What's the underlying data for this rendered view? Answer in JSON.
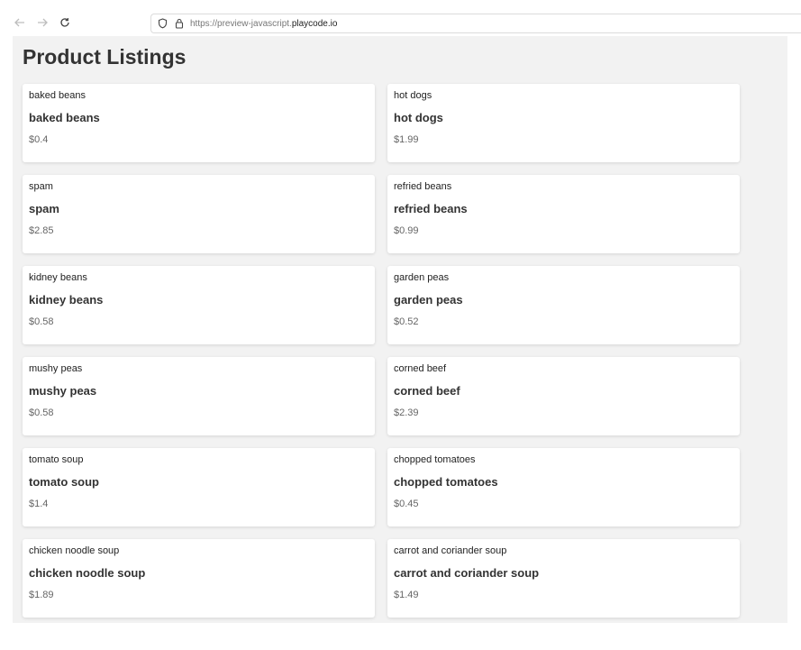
{
  "browser": {
    "url_prefix": "https://preview-javascript.",
    "url_host": "playcode.io"
  },
  "page": {
    "title": "Product Listings"
  },
  "products": [
    {
      "image_alt": "baked beans",
      "name": "baked beans",
      "price": "$0.4"
    },
    {
      "image_alt": "hot dogs",
      "name": "hot dogs",
      "price": "$1.99"
    },
    {
      "image_alt": "spam",
      "name": "spam",
      "price": "$2.85"
    },
    {
      "image_alt": "refried beans",
      "name": "refried beans",
      "price": "$0.99"
    },
    {
      "image_alt": "kidney beans",
      "name": "kidney beans",
      "price": "$0.58"
    },
    {
      "image_alt": "garden peas",
      "name": "garden peas",
      "price": "$0.52"
    },
    {
      "image_alt": "mushy peas",
      "name": "mushy peas",
      "price": "$0.58"
    },
    {
      "image_alt": "corned beef",
      "name": "corned beef",
      "price": "$2.39"
    },
    {
      "image_alt": "tomato soup",
      "name": "tomato soup",
      "price": "$1.4"
    },
    {
      "image_alt": "chopped tomatoes",
      "name": "chopped tomatoes",
      "price": "$0.45"
    },
    {
      "image_alt": "chicken noodle soup",
      "name": "chicken noodle soup",
      "price": "$1.89"
    },
    {
      "image_alt": "carrot and coriander soup",
      "name": "carrot and coriander soup",
      "price": "$1.49"
    }
  ]
}
